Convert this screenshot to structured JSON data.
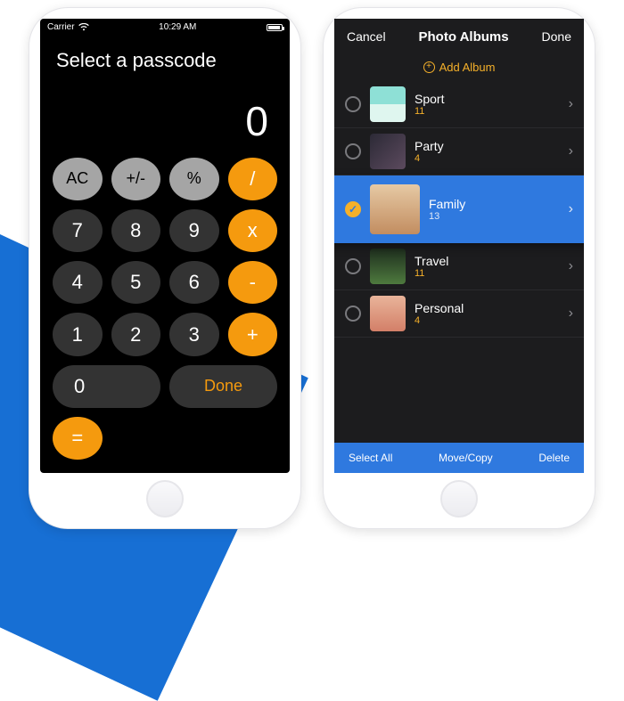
{
  "calculator": {
    "status_carrier": "Carrier",
    "status_time": "10:29 AM",
    "title": "Select a passcode",
    "value": "0",
    "keys": {
      "ac": "AC",
      "sign": "+/-",
      "pct": "%",
      "div": "/",
      "k7": "7",
      "k8": "8",
      "k9": "9",
      "mul": "x",
      "k4": "4",
      "k5": "5",
      "k6": "6",
      "sub": "-",
      "k1": "1",
      "k2": "2",
      "k3": "3",
      "add": "+",
      "k0": "0",
      "done": "Done",
      "eq": "="
    }
  },
  "albums": {
    "header": {
      "cancel": "Cancel",
      "title": "Photo Albums",
      "done": "Done"
    },
    "add_label": "Add Album",
    "items": [
      {
        "name": "Sport",
        "count": "11",
        "selected": false,
        "thumb": "th-sport"
      },
      {
        "name": "Party",
        "count": "4",
        "selected": false,
        "thumb": "th-party"
      },
      {
        "name": "Family",
        "count": "13",
        "selected": true,
        "thumb": "th-family"
      },
      {
        "name": "Travel",
        "count": "11",
        "selected": false,
        "thumb": "th-travel"
      },
      {
        "name": "Personal",
        "count": "4",
        "selected": false,
        "thumb": "th-personal"
      }
    ],
    "footer": {
      "select_all": "Select All",
      "move_copy": "Move/Copy",
      "delete": "Delete"
    }
  }
}
